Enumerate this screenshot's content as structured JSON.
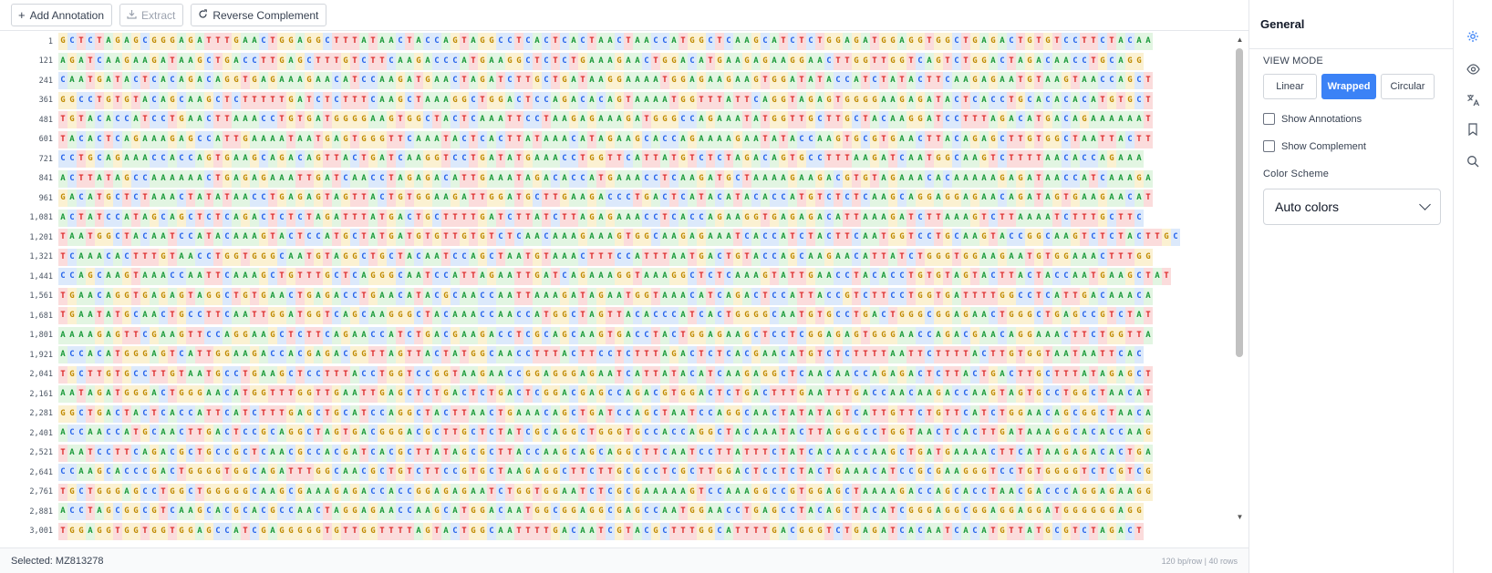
{
  "toolbar": {
    "add_annotation": "Add Annotation",
    "extract": "Extract",
    "reverse_complement": "Reverse Complement"
  },
  "sequence": {
    "rows": [
      {
        "start": "1",
        "bases": "GCTCTAGAGCGGGAGATTTGAACTGGAGGCTTTATAACTACCAGTAGGCCTCACTCACTAACTAACCATGGCTCAAGCATCTCTGGAGATGGAGGTGGCTGAGACTGTGTCCTTCTACAA"
      },
      {
        "start": "121",
        "bases": "AGATCAAGAAGATAAGCTGACCTTGAGCTTTGTCTTCAAGACCCATGAAGGCTCTCTGAAAGAACTGGACATGAAGAGAAGGAACTTGGTTGGTCAGTCTGGACTAGACAACCTGCAGG"
      },
      {
        "start": "241",
        "bases": "CAATGATACTCACAGACAGGTGAGAAAGAACATCCAAGATGAACTAGATCTTGCTGATAAGGAAAATGGAGAAGAAGTGGATATACCATCTATACTTCAAGAGAATGTAAGTAACCAGCT"
      },
      {
        "start": "361",
        "bases": "GGCCTGTGTACAGCAAGCTCTTTTTGATCTCTTTCAAGCTAAAGGCTGGACTCCAGACACAGTAAAATGGTTTATTCAGGTAGAGTGGGGAAGAGATACTCACCTGCACACACATGTGCT"
      },
      {
        "start": "481",
        "bases": "TGTACACCATCCTGAACTTAAACCTGTGATGGGGAAGTGGCTACTCAAATTCCTAAGAGAAAGATGGGCCAGAAATATGGTTGCTTGCTACAAGGATCCTTTAGACATGACAGAAAAAAT"
      },
      {
        "start": "601",
        "bases": "TACACTCAGAAAGAGCCATTGAAAATAATGAGTGGGTTCAAATACTCACTTATAAACATAGAAGCACCAGAAAAGAATATACCAAGTGCGTGAACTTACAGAGCTTGTGGCTAATTACTT"
      },
      {
        "start": "721",
        "bases": "CCTGCAGAAACCACCAGTGAAGCAGACAGTTACTGATCAAGGTCCTGATATGAAACCTGGTTCATTATGTCTCTAGACAGTGCCTTTAAGATCAATGGCAAGTCTTTTAACACCAGAAA"
      },
      {
        "start": "841",
        "bases": "ACTTATAGCCAAAAAACTGAGAGAAATTGATCAACCTAGAGACATTGAAATAGACACCATGAAACCTCAAGATGCTAAAAGAAGACGTGTAGAAACACAAAAAGAGATAACCATCAAAGA"
      },
      {
        "start": "961",
        "bases": "GACATGCTCTAAACTATATAACCTGAGAGTAGTTACTGTGGAAGATTGGATGCTTGAAGACCCTGACTCATACATACACCATGTCTCTCAAGCAGGAGGAGAACAGATAGTGAAGAACAT"
      },
      {
        "start": "1,081",
        "bases": "ACTATCCATAGCAGCTCTCAGACTCTCTAGATTTATGACTGCTTTTGATCTTATCTTAGAGAAACCTCACCAGAAGGTGAGAGACATTAAAGATCTTAAAGTCTTAAAATCTTTGCTTC"
      },
      {
        "start": "1,201",
        "bases": "TAATGGCTACAATCCATACAAAGTACTCCATGCTATGATGTGTTGTGTCTCAACAAAGAAAGTGGCAAGAGAAATCACCATCTACTTCAATGGTCCTGCAAGTACCGGCAAGTCTCTACTTGC"
      },
      {
        "start": "1,321",
        "bases": "TCAAACACTTTGTAACCTGGTGGGCAATGTAGGCTGCTACAATCCAGCTAATGTAAACTTTCCATTTAATGACTGTACCAGCAAGAACATTATCTGGGTGGAAGAATGTGGAAACTTTGG"
      },
      {
        "start": "1,441",
        "bases": "CCAGCAAGTAAACCAATTCAAAGCTGTTTGCTCAGGGCAATCCATTAGAATTGATCAGAAAGGTAAAGGCTCTCAAAGTATTGAACCTACACCTGTGTAGTACTTACTACCAATGAAGCTAT"
      },
      {
        "start": "1,561",
        "bases": "TGAACAGGTGAGAGTAGGCTGTGAACTGAGACCTGAACATACGCAACCAATTAAAGATAGAATGGTAAACATCAGACTCCATTACCGTCTTCCTGGTGATTTTGGCCTCATTGACAAACA"
      },
      {
        "start": "1,681",
        "bases": "TGAATATGCAACTGCCTTCAATTGGATGGTCAGCAAGGGCTACAAACCAACCATGGCTAGTTACACCCATCACTGGGGCAATGTGCCTGACTGGGCGGAGAACTGGGCTGAGCCGTCTAT"
      },
      {
        "start": "1,801",
        "bases": "AAAAGAGTTCGAAGTTCCAGGAAGCTCTTCAGAACCATCTGACGAAGACCTCGCAGCAAGTGACCTACTGGAGAAGCTCCTCGGAGAGTGGGAACCAGACGAACAGGAAACTTCTGGTTA"
      },
      {
        "start": "1,921",
        "bases": "ACCACATGGGAGTCATTGGAAGACCACGAGACGGTTAGTTACTATGGCAACCTTTACTTCCTCTTTAGACTCTCACGAACATGTCTCTTTTAATTCTTTTACTTGTGGTAATAATTCAC"
      },
      {
        "start": "2,041",
        "bases": "TGCTTGTGCCTTGTAATGCCTGAAGCTCCTTTACCTGGTCCGGTAAGAACCGGAGGGAGAATCATTATACATCAAGAGGCTCAACAACCAGAGACTCTTACTGACTTGCTTTATAGAGCT"
      },
      {
        "start": "2,161",
        "bases": "AATAGATGGGACTGGGAACATGGTTTGGTTGAATTGAGCTCTGACTCTGACTCGGACGAGCCAGACGTGGACTCTGACTTTGAATTTGACCAACAAGACCAAGTAGTGCCTGGCTAACAT"
      },
      {
        "start": "2,281",
        "bases": "GGCTGACTACTCACCATTCATCTTTGAGCTGCATCCAGGCTACTTAACTGAAACAGCTGATCCAGCTAATCCAGGCAACTATATAGTCATTGTTCTGTTCATCTGGAACAGCGGCTAACA"
      },
      {
        "start": "2,401",
        "bases": "ACCAACCATGCAACTTGACTCCGCAGGCTAGTGACGGGACGCTTGCTCTATCGCAGGCTGGGTGCCACCAGGCTACAAATACTTAGGGCCTGGTAACTCACTTGATAAAGGCACACCAAG"
      },
      {
        "start": "2,521",
        "bases": "TAATCCTTCAGACGCTGCCGCTCAACGCCACGATCACGCTTATAGCGCTTACCAAGCAGCAGGCTTCAATCCTTATTTCTATCACAACCAAGCTGATGAAAACTTCATAAGAGACACTGA"
      },
      {
        "start": "2,641",
        "bases": "CCAAGCACCCGACTGGGGTGGCAGATTTGGCAACGCTGTCTTCCGTGCTAAGAGGCTTCTTGCGCCTCGCTTGGACTCCTCTACTGAAACATCCGCGAAGGGTCCTGTGGGGTCTCGTCG"
      },
      {
        "start": "2,761",
        "bases": "TGCTGGGAGCCTGGCTGGGGGCAAGCGAAAGAGACCACCGGAGAGAATCTGGTGGAATCTCGCGAAAAAGTCCAAAGGCCGTGGAGCTAAAAGACCAGCACCTAACGACCCAGGAGAAGG"
      },
      {
        "start": "2,881",
        "bases": "ACCTAGCGGCGTCAAGCACGCACGCCAACTAGGAGAACCAAGCATGGACAATGGCGGAGGCGAGCCAATGGAACCTGAGCCTACAGCTACATCGGGAGGCGGAGGAGGATGGGGGGAGG"
      },
      {
        "start": "3,001",
        "bases": "TGGAGGTGGTGGTGGAGCCATCGAGGGGGTGTTGGTTTTAGTACTGGCAATTTTGACAATCGTACGCTTTGGCATTTTGACGGGTCTGAGATCACAATCACATGTTATGCGTCTAGACT"
      }
    ]
  },
  "footer": {
    "selected": "Selected: MZ813278",
    "stats": "120 bp/row | 40 rows"
  },
  "panel": {
    "title": "General",
    "view_mode_label": "VIEW MODE",
    "view_modes": [
      "Linear",
      "Wrapped",
      "Circular"
    ],
    "active_view_mode": "Wrapped",
    "show_annotations": "Show Annotations",
    "show_complement": "Show Complement",
    "color_scheme_label": "Color Scheme",
    "color_scheme_value": "Auto colors"
  },
  "colors": {
    "A": "#1a9a3a",
    "C": "#2563eb",
    "G": "#c08a00",
    "T": "#dc2626",
    "accent": "#3b82f6"
  },
  "rail": [
    "settings-icon",
    "eye-icon",
    "translate-icon",
    "bookmark-icon",
    "search-icon"
  ]
}
